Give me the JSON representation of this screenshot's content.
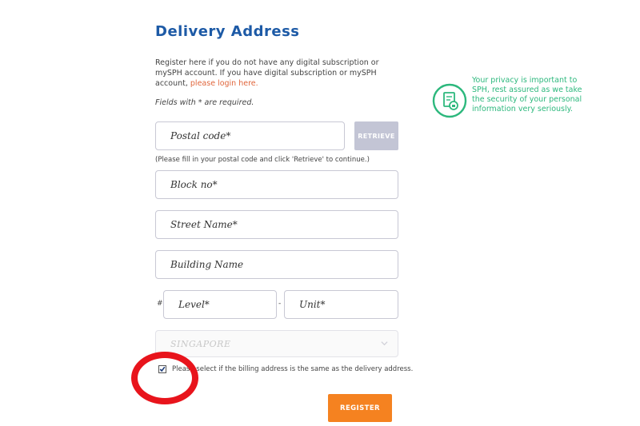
{
  "form": {
    "title": "Delivery Address",
    "intro_text": "Register here if you do not have any digital subscription or mySPH account. If you have digital subscription or mySPH account,",
    "login_link": "please login here.",
    "required_note": "Fields with * are required.",
    "postal_code_placeholder": "Postal code*",
    "retrieve_label": "RETRIEVE",
    "postal_hint": "(Please fill in your postal code and click 'Retrieve' to continue.)",
    "block_placeholder": "Block no*",
    "street_placeholder": "Street Name*",
    "building_placeholder": "Building Name",
    "hash_symbol": "#",
    "dash_symbol": "-",
    "level_placeholder": "Level*",
    "unit_placeholder": "Unit*",
    "country_value": "SINGAPORE",
    "billing_checkbox_checked": true,
    "billing_label": "Please select if the billing address is the same as the delivery address.",
    "register_label": "REGISTER"
  },
  "privacy": {
    "text": "Your privacy is important to SPH, rest assured as we take the security of your personal information very seriously.",
    "icon": "shield-lock-icon"
  },
  "colors": {
    "title": "#1d5aa6",
    "link": "#e0663c",
    "privacy": "#2db87d",
    "register": "#f58220",
    "retrieve": "#c3c5d5",
    "annotation": "#e8141c"
  },
  "annotation": {
    "shape": "red-circle",
    "target": "billing-checkbox"
  }
}
